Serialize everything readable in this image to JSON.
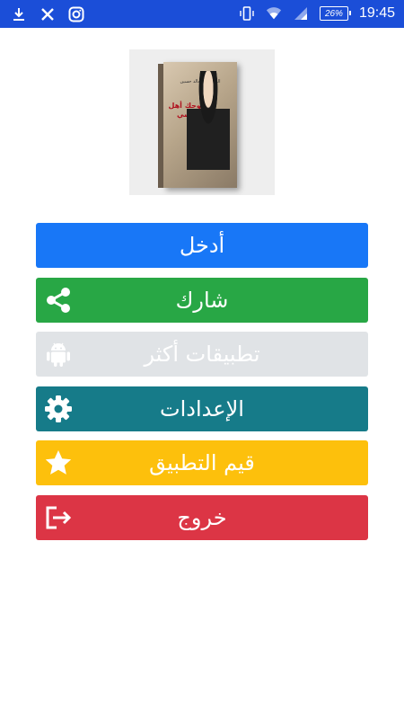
{
  "status_bar": {
    "time": "19:45",
    "battery": "26%",
    "left_icons": [
      "download-icon",
      "x-icon",
      "instagram-icon"
    ],
    "right_icons": [
      "vibrate-icon",
      "wifi-icon",
      "signal-icon",
      "battery-icon"
    ]
  },
  "cover": {
    "title": "زوجك أهل باسي",
    "author": "المستشار خالد حسين"
  },
  "menu": {
    "items": [
      {
        "label": "أدخل",
        "color": "#1877f7",
        "icon": ""
      },
      {
        "label": "شارك",
        "color": "#28a745",
        "icon": "share-icon"
      },
      {
        "label": "تطبيقات أكثر",
        "color": "#e0e3e6",
        "icon": "android-icon"
      },
      {
        "label": "الإعدادات",
        "color": "#167b89",
        "icon": "gear-icon"
      },
      {
        "label": "قيم التطبيق",
        "color": "#fdc00c",
        "icon": "star-icon"
      },
      {
        "label": "خروج",
        "color": "#dc3545",
        "icon": "exit-icon"
      }
    ]
  }
}
